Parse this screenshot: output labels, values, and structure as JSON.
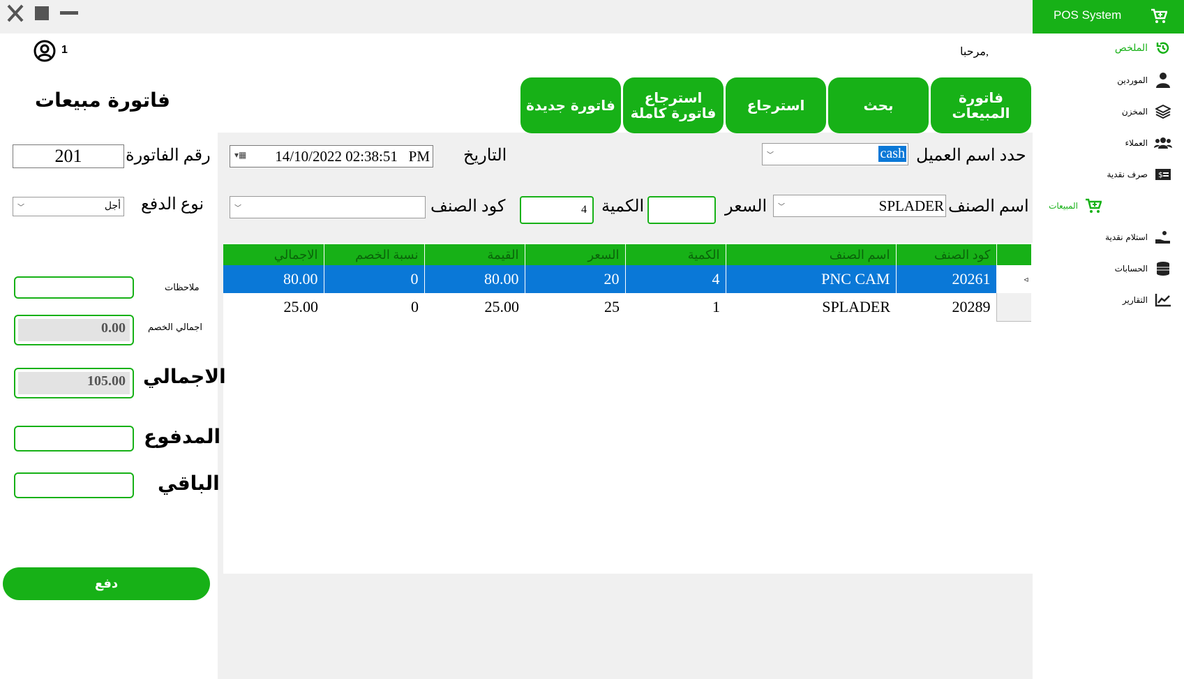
{
  "app": {
    "brand": "POS  System",
    "welcome": "مرحبا,",
    "user_number": "1"
  },
  "colors": {
    "accent": "#17b117",
    "selection": "#0a78d7",
    "panel": "#f0f0f0"
  },
  "sidebar": {
    "items": [
      {
        "label": "الملخص",
        "icon": "history-icon",
        "active": true
      },
      {
        "label": "الموردين",
        "icon": "suppliers-icon",
        "active": false
      },
      {
        "label": "المخزن",
        "icon": "layers-icon",
        "active": false
      },
      {
        "label": "العملاء",
        "icon": "users-icon",
        "active": false
      },
      {
        "label": "صرف نقدية",
        "icon": "money-icon",
        "active": false
      },
      {
        "label": "المبيعات",
        "icon": "cart-icon",
        "active": true
      },
      {
        "label": "استلام نقدية",
        "icon": "hand-coin-icon",
        "active": false
      },
      {
        "label": "الحسابات",
        "icon": "coins-icon",
        "active": false
      },
      {
        "label": "التقارير",
        "icon": "chart-icon",
        "active": false
      }
    ]
  },
  "tabs": {
    "sales_invoice": "فاتورة المبيعات",
    "search": "بحث",
    "return": "استرجاع",
    "full_return": "استرجاع فاتورة كاملة",
    "new_invoice": "فاتورة جديدة"
  },
  "form": {
    "customer_label": "حدد اسم العميل",
    "customer_value": "cash",
    "date_label": "التاريخ",
    "date_value": "14/10/2022 02:38:51   PM",
    "item_name_label": "اسم الصنف",
    "item_name_value": "SPLADER",
    "price_label": "السعر",
    "price_value": "",
    "quantity_label": "الكمية",
    "quantity_value": "4",
    "item_code_label": "كود الصنف",
    "item_code_value": ""
  },
  "table": {
    "headers": [
      "كود الصنف",
      "اسم الصنف",
      "الكمية",
      "السعر",
      "القيمة",
      "نسبة الخصم",
      "الاجمالي"
    ],
    "rows": [
      [
        "20261",
        "PNC CAM",
        "4",
        "20",
        "80.00",
        "0",
        "80.00"
      ],
      [
        "20289",
        "SPLADER",
        "1",
        "25",
        "25.00",
        "0",
        "25.00"
      ]
    ],
    "selected_row_marker": "◃"
  },
  "summary": {
    "title": "فاتورة مبيعات",
    "invoice_no_label": "رقم الفاتورة",
    "invoice_no_value": "201",
    "payment_type_label": "نوع الدفع",
    "payment_type_value": "أجل",
    "notes_label": "ملاحظات",
    "notes_value": "",
    "discount_label": "اجمالي الخصم",
    "discount_value": "0.00",
    "total_label": "الاجمالي",
    "total_value": "105.00",
    "paid_label": "المدفوع",
    "paid_value": "",
    "remaining_label": "الباقي",
    "remaining_value": "",
    "pay_button": "دفع"
  }
}
